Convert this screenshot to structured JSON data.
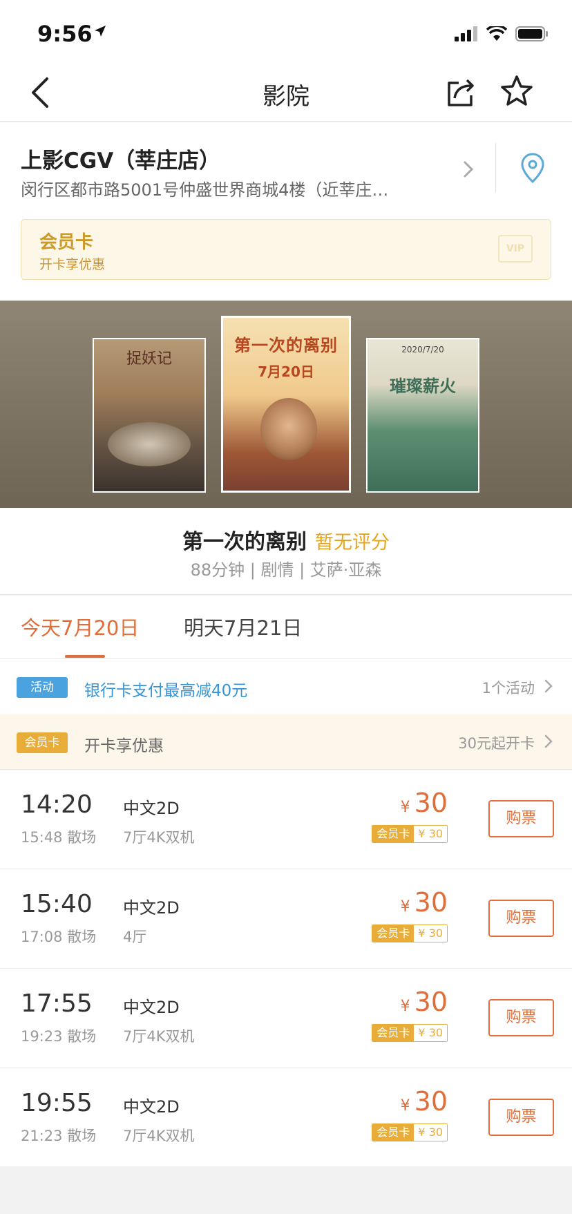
{
  "status_bar": {
    "time": "9:56"
  },
  "nav": {
    "title": "影院"
  },
  "cinema": {
    "name": "上影CGV（莘庄店）",
    "address": "闵行区都市路5001号仲盛世界商城4楼（近莘庄…"
  },
  "member_banner": {
    "title": "会员卡",
    "subtitle": "开卡享优惠",
    "vip_label": "VIP"
  },
  "posters": [
    {
      "caption": "捉妖记"
    },
    {
      "caption": "第一次的离别",
      "date": "7月20日"
    },
    {
      "caption": "璀璨薪火",
      "date": "2020/7/20"
    }
  ],
  "movie": {
    "title": "第一次的离别",
    "rating": "暂无评分",
    "meta": "88分钟 | 剧情 | 艾萨·亚森"
  },
  "date_tabs": [
    {
      "label": "今天7月20日",
      "active": true
    },
    {
      "label": "明天7月21日",
      "active": false
    }
  ],
  "activity": {
    "tag": "活动",
    "text": "银行卡支付最高减40元",
    "right": "1个活动"
  },
  "member_row": {
    "tag": "会员卡",
    "text": "开卡享优惠",
    "right": "30元起开卡"
  },
  "showtimes": [
    {
      "start": "14:20",
      "end": "15:48 散场",
      "lang": "中文2D",
      "hall": "7厅4K双机",
      "price": "30",
      "member_tag": "会员卡",
      "member_price": "¥ 30",
      "buy": "购票"
    },
    {
      "start": "15:40",
      "end": "17:08 散场",
      "lang": "中文2D",
      "hall": "4厅",
      "price": "30",
      "member_tag": "会员卡",
      "member_price": "¥ 30",
      "buy": "购票"
    },
    {
      "start": "17:55",
      "end": "19:23 散场",
      "lang": "中文2D",
      "hall": "7厅4K双机",
      "price": "30",
      "member_tag": "会员卡",
      "member_price": "¥ 30",
      "buy": "购票"
    },
    {
      "start": "19:55",
      "end": "21:23 散场",
      "lang": "中文2D",
      "hall": "7厅4K双机",
      "price": "30",
      "member_tag": "会员卡",
      "member_price": "¥ 30",
      "buy": "购票"
    }
  ],
  "currency_symbol": "¥",
  "colors": {
    "accent": "#e06e3a",
    "member_gold": "#e7ad38",
    "activity_blue": "#4aa3df",
    "rating_gold": "#e6a51e"
  },
  "icons": [
    "location-arrow-icon",
    "signal-icon",
    "wifi-icon",
    "battery-icon",
    "back-icon",
    "share-icon",
    "star-icon",
    "chevron-right-icon",
    "location-pin-icon"
  ]
}
